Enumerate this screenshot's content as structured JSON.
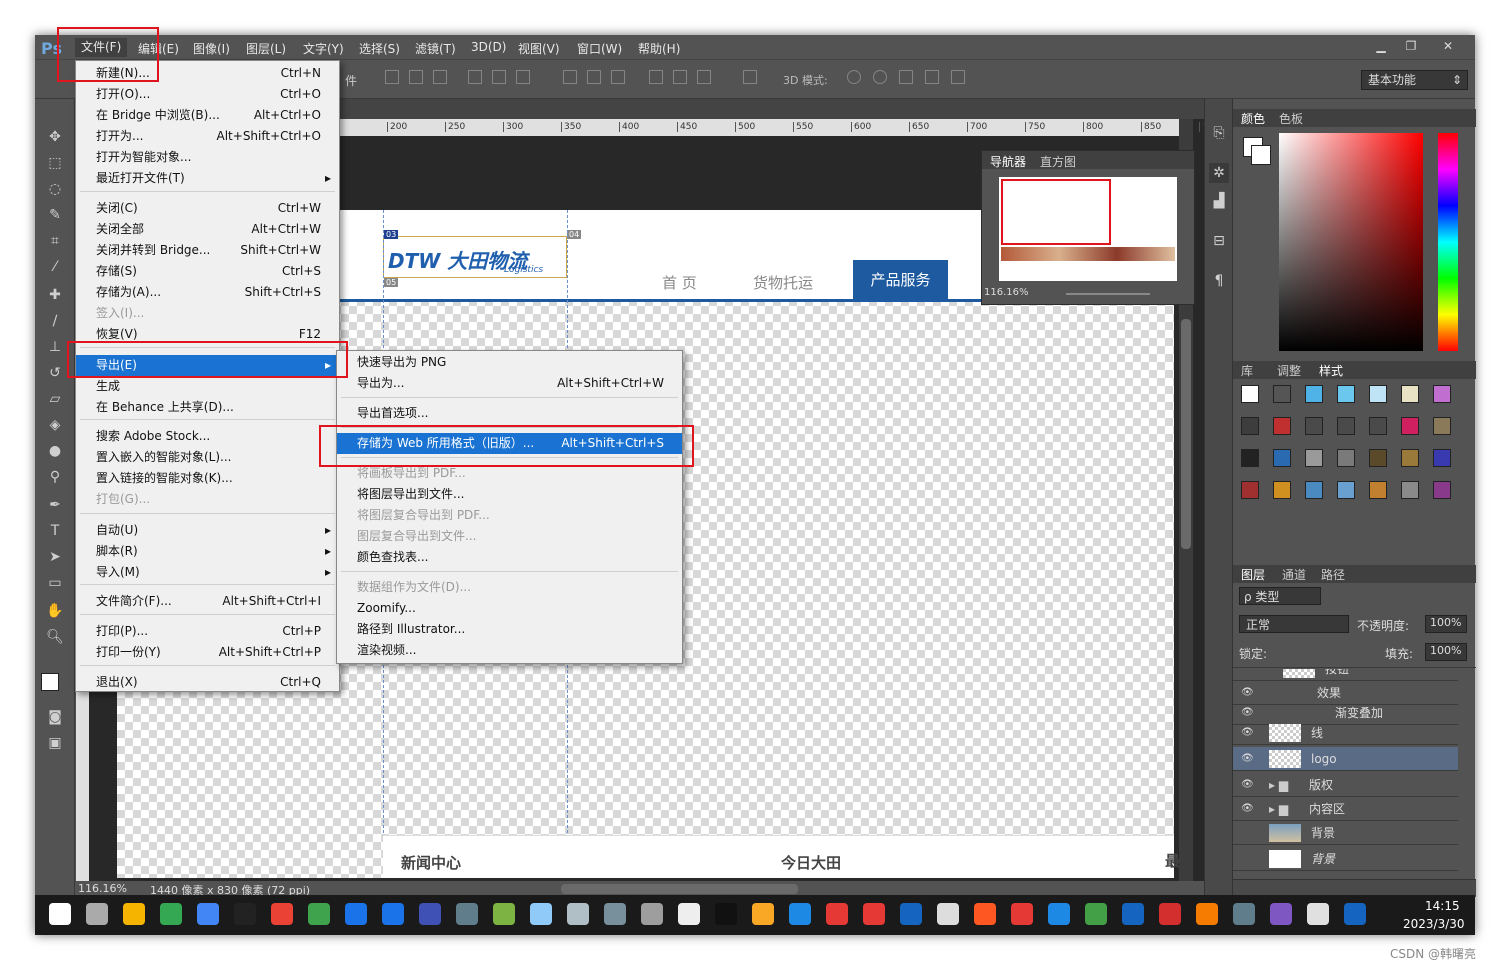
{
  "app": {
    "logo": "Ps"
  },
  "menubar": {
    "items": [
      "文件(F)",
      "编辑(E)",
      "图像(I)",
      "图层(L)",
      "文字(Y)",
      "选择(S)",
      "滤镜(T)",
      "3D(D)",
      "视图(V)",
      "窗口(W)",
      "帮助(H)"
    ]
  },
  "window_controls": {
    "min": "▁",
    "restore": "❐",
    "close": "✕"
  },
  "optbar": {
    "mode_label": "3D 模式:",
    "workspace": "基本功能",
    "partial_text": "件"
  },
  "ruler_ticks": [
    "200",
    "250",
    "300",
    "350",
    "400",
    "450",
    "500",
    "550",
    "600",
    "650",
    "700",
    "750",
    "800",
    "850",
    "9("
  ],
  "file_menu": [
    {
      "label": "新建(N)...",
      "shortcut": "Ctrl+N"
    },
    {
      "label": "打开(O)...",
      "shortcut": "Ctrl+O"
    },
    {
      "label": "在 Bridge 中浏览(B)...",
      "shortcut": "Alt+Ctrl+O"
    },
    {
      "label": "打开为...",
      "shortcut": "Alt+Shift+Ctrl+O"
    },
    {
      "label": "打开为智能对象..."
    },
    {
      "label": "最近打开文件(T)",
      "arrow": "▸"
    },
    {
      "label": "关闭(C)",
      "shortcut": "Ctrl+W"
    },
    {
      "label": "关闭全部",
      "shortcut": "Alt+Ctrl+W"
    },
    {
      "label": "关闭并转到 Bridge...",
      "shortcut": "Shift+Ctrl+W"
    },
    {
      "label": "存储(S)",
      "shortcut": "Ctrl+S"
    },
    {
      "label": "存储为(A)...",
      "shortcut": "Shift+Ctrl+S"
    },
    {
      "label": "签入(I)..."
    },
    {
      "label": "恢复(V)",
      "shortcut": "F12"
    },
    {
      "label": "导出(E)",
      "arrow": "▸"
    },
    {
      "label": "生成"
    },
    {
      "label": "在 Behance 上共享(D)..."
    },
    {
      "label": "搜索 Adobe Stock..."
    },
    {
      "label": "置入嵌入的智能对象(L)..."
    },
    {
      "label": "置入链接的智能对象(K)..."
    },
    {
      "label": "打包(G)..."
    },
    {
      "label": "自动(U)",
      "arrow": "▸"
    },
    {
      "label": "脚本(R)",
      "arrow": "▸"
    },
    {
      "label": "导入(M)",
      "arrow": "▸"
    },
    {
      "label": "文件简介(F)...",
      "shortcut": "Alt+Shift+Ctrl+I"
    },
    {
      "label": "打印(P)...",
      "shortcut": "Ctrl+P"
    },
    {
      "label": "打印一份(Y)",
      "shortcut": "Alt+Shift+Ctrl+P"
    },
    {
      "label": "退出(X)",
      "shortcut": "Ctrl+Q"
    }
  ],
  "export_menu": [
    {
      "label": "快速导出为 PNG"
    },
    {
      "label": "导出为...",
      "shortcut": "Alt+Shift+Ctrl+W"
    },
    {
      "label": "导出首选项..."
    },
    {
      "label": "存储为 Web 所用格式（旧版）...",
      "shortcut": "Alt+Shift+Ctrl+S"
    },
    {
      "label": "将画板导出到 PDF..."
    },
    {
      "label": "将图层导出到文件..."
    },
    {
      "label": "将图层复合导出到 PDF..."
    },
    {
      "label": "图层复合导出到文件..."
    },
    {
      "label": "颜色查找表..."
    },
    {
      "label": "数据组作为文件(D)..."
    },
    {
      "label": "Zoomify..."
    },
    {
      "label": "路径到 Illustrator..."
    },
    {
      "label": "渲染视频..."
    }
  ],
  "canvas": {
    "nav1": "首 页",
    "nav2": "货物托运",
    "nav3": "产品服务",
    "news": "新闻中心",
    "today": "今日大田",
    "edge": "最",
    "logo_text": "DTW 大田物流",
    "logo_sub": "Logistics",
    "slice1": "03",
    "slice2": "04",
    "slice3": "05"
  },
  "status": {
    "zoom": "116.16%",
    "doc": "1440 像素 x 830 像素 (72 ppi)"
  },
  "navigator": {
    "tab1": "导航器",
    "tab2": "直方图",
    "zoom": "116.16%"
  },
  "color_panel": {
    "tab1": "颜色",
    "tab2": "色板"
  },
  "style_panel": {
    "tab1": "库",
    "tab2": "调整",
    "tab3": "样式"
  },
  "layers_panel": {
    "tab1": "图层",
    "tab2": "通道",
    "tab3": "路径",
    "filter": "ρ 类型",
    "blend": "正常",
    "opacity_label": "不透明度:",
    "opacity": "100%",
    "lock_label": "锁定:",
    "fill_label": "填充:",
    "fill": "100%",
    "layers": [
      {
        "name": "按钮"
      },
      {
        "name": "效果"
      },
      {
        "name": "渐变叠加"
      },
      {
        "name": "线"
      },
      {
        "name": "logo"
      },
      {
        "name": "版权"
      },
      {
        "name": "内容区"
      },
      {
        "name": "背景"
      },
      {
        "name": "背景"
      }
    ]
  },
  "taskbar": {
    "time": "14:15",
    "date": "2023/3/30"
  },
  "watermark": "CSDN @韩曙亮",
  "colors": {
    "highlight": "#1a73d2",
    "red_box": "#e0141c",
    "ps_gray": "#535353"
  }
}
